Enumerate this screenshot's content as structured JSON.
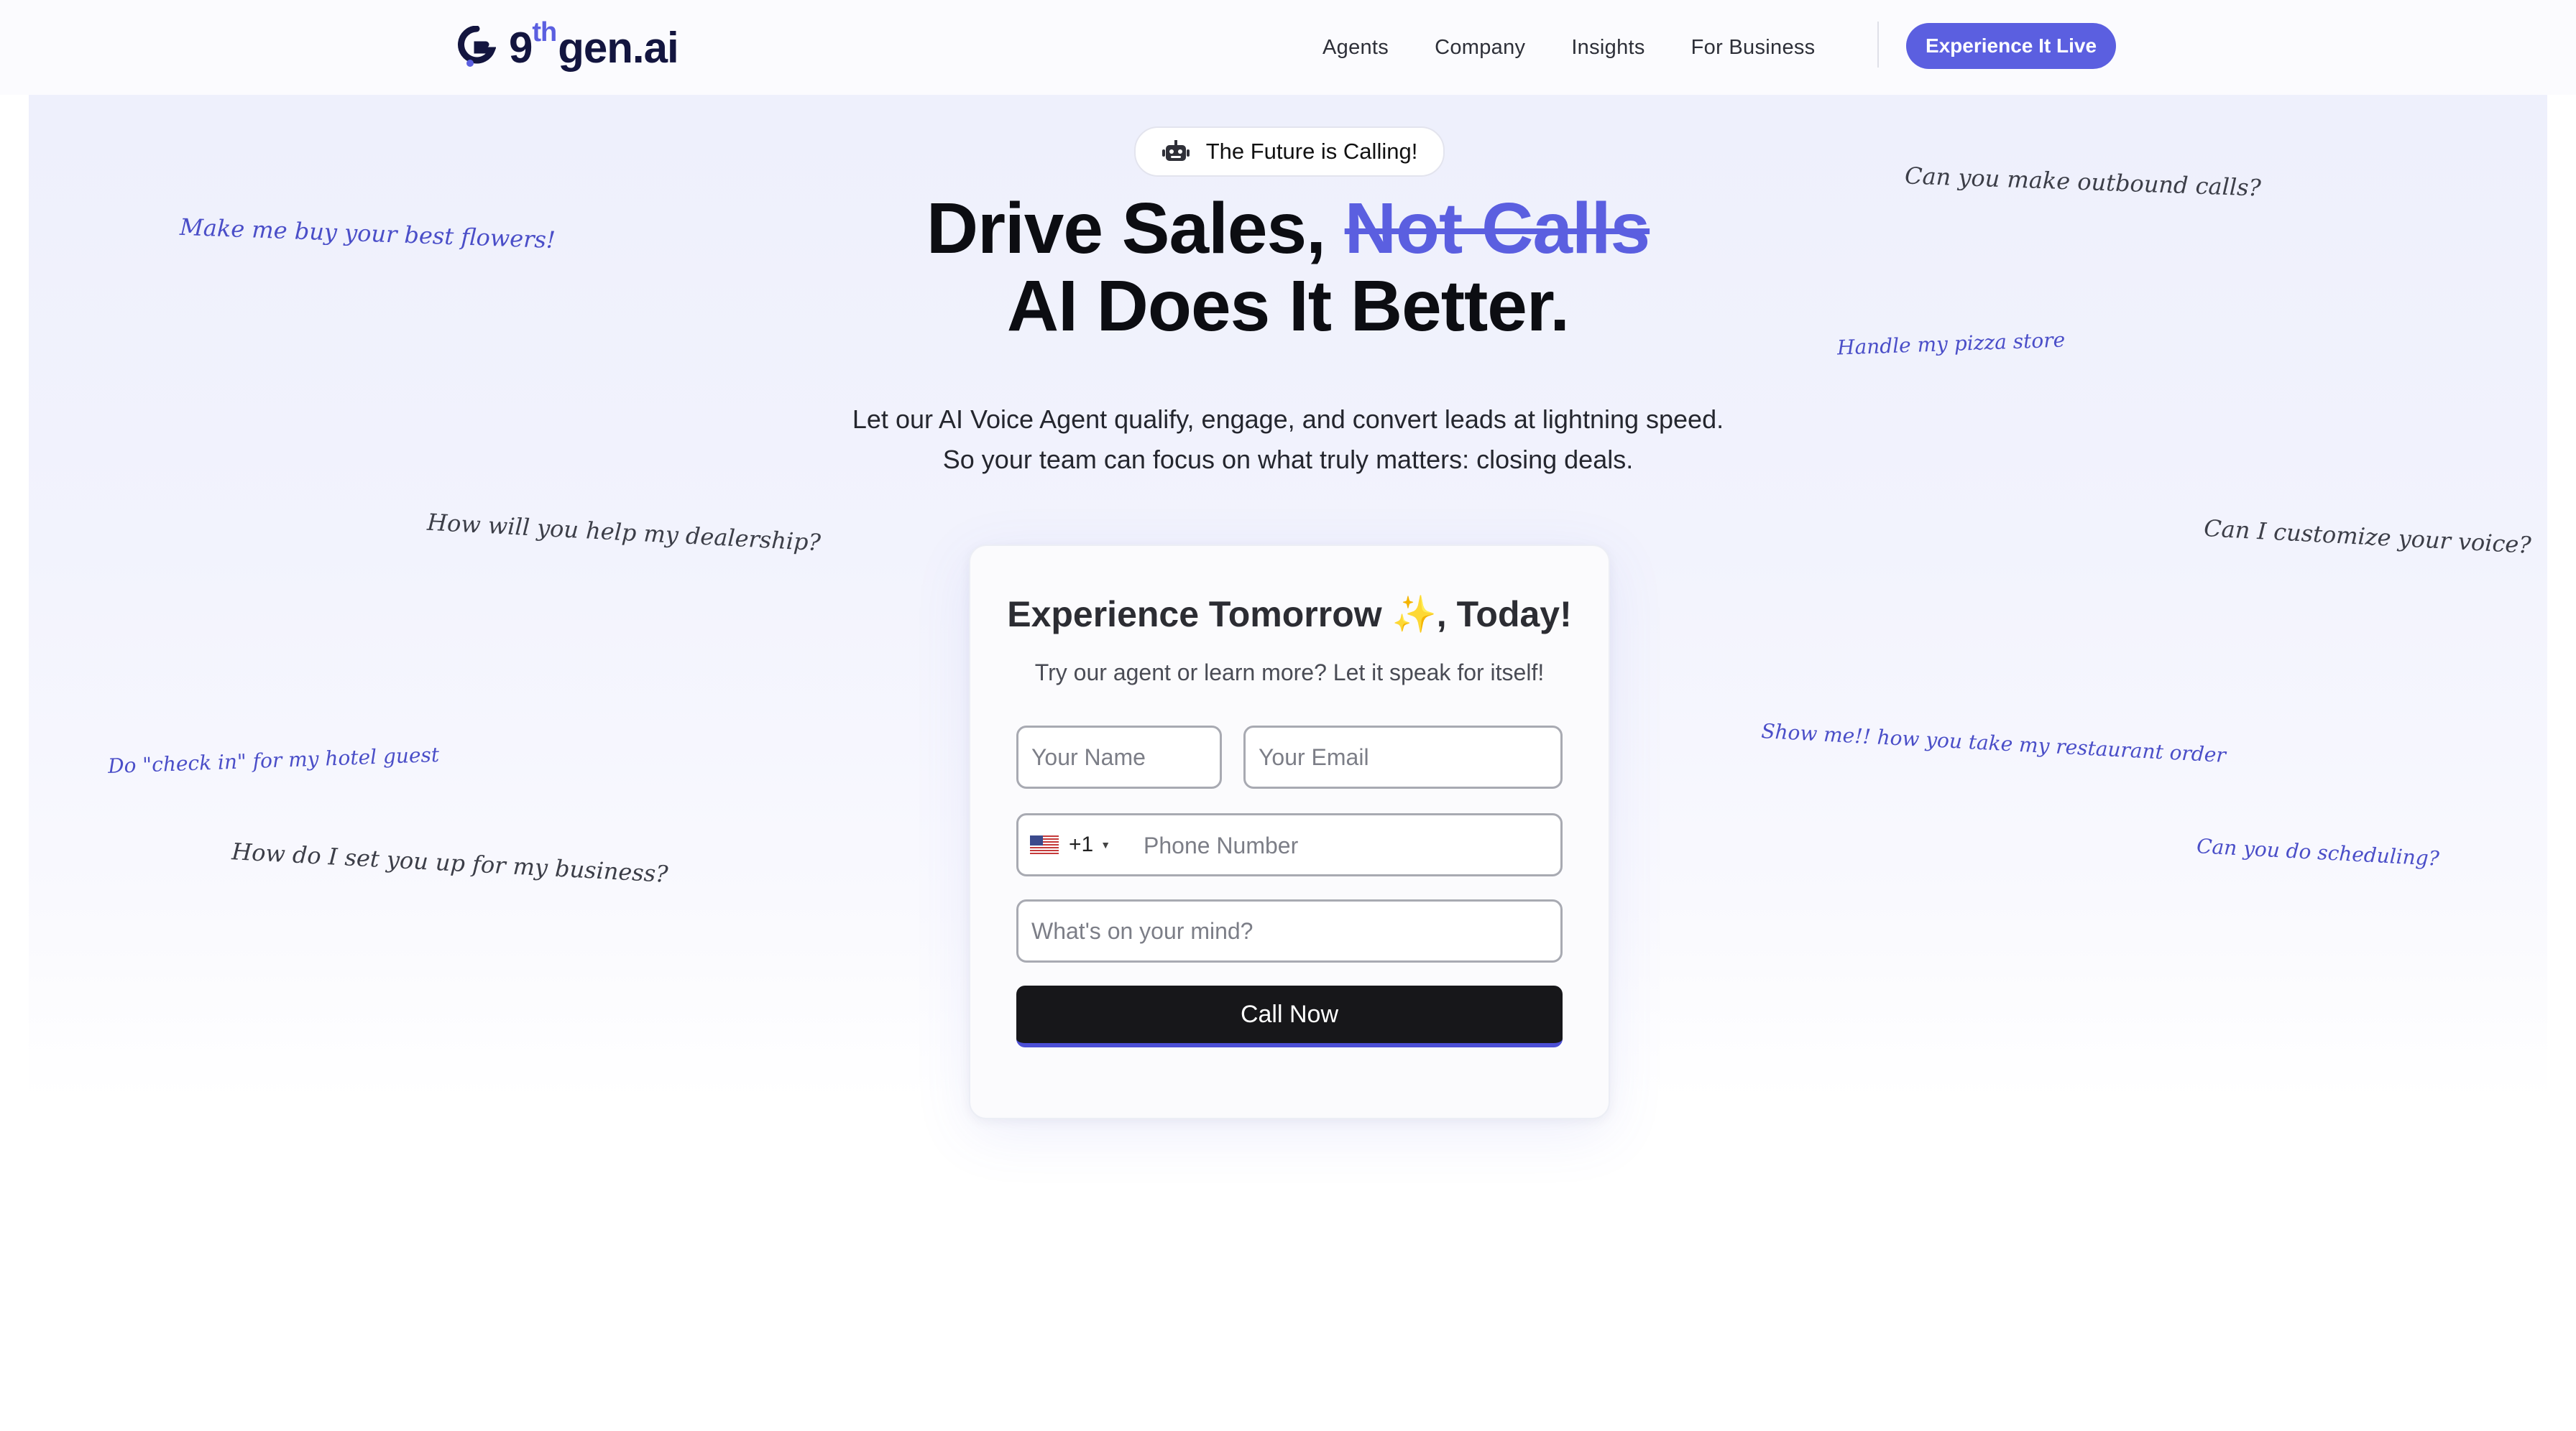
{
  "brand": {
    "name_prefix": "9",
    "name_sup": "th",
    "name_suffix": "gen.ai",
    "accent": "#5b5fe0"
  },
  "nav": {
    "links": [
      "Agents",
      "Company",
      "Insights",
      "For Business"
    ],
    "cta": "Experience It Live"
  },
  "hero": {
    "pill": "The Future is Calling!",
    "headline_part1": "Drive Sales,",
    "headline_strike": "Not Calls",
    "headline_line2": "AI Does It Better.",
    "sub_line1": "Let our AI Voice Agent qualify, engage, and convert leads at lightning speed.",
    "sub_line2": "So your team can focus on what truly matters: closing deals."
  },
  "notes": [
    "Make me buy your best flowers!",
    "How will you help my dealership?",
    "Do \"check in\" for my hotel guest",
    "How do I set you up for my business?",
    "Can you make outbound calls?",
    "Handle my pizza store",
    "Can I customize your voice?",
    "Show me!! how you take my restaurant order",
    "Can you do scheduling?"
  ],
  "form": {
    "title": "Experience Tomorrow ✨, Today!",
    "subtitle": "Try our agent or learn more? Let it speak for itself!",
    "name_placeholder": "Your Name",
    "email_placeholder": "Your Email",
    "country_code": "+1",
    "phone_placeholder": "Phone Number",
    "mind_placeholder": "What's on your mind?",
    "submit": "Call Now"
  }
}
